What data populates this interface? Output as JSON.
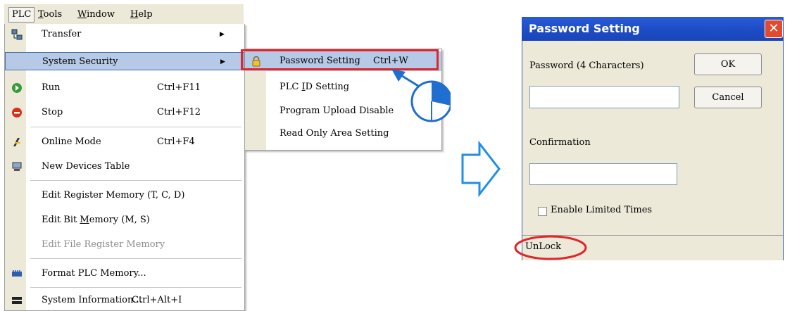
{
  "menubar": {
    "items": [
      "PLC",
      "Tools",
      "Window",
      "Help"
    ],
    "tools_prefix": "T",
    "tools_rest": "ools",
    "window_prefix": "W",
    "window_rest": "indow",
    "help_prefix": "H",
    "help_rest": "elp"
  },
  "plc_menu": {
    "transfer": "Transfer",
    "system_security": "System Security",
    "run": "Run",
    "run_shortcut": "Ctrl+F11",
    "stop": "Stop",
    "stop_shortcut": "Ctrl+F12",
    "online_mode": "Online Mode",
    "online_mode_shortcut": "Ctrl+F4",
    "new_devices_table": "New Devices Table",
    "edit_register_memory": "Edit Register Memory (T, C, D)",
    "edit_bit_memory_a": "Edit Bit ",
    "edit_bit_memory_u": "M",
    "edit_bit_memory_b": "emory (M, S)",
    "edit_file_register_memory": "Edit File Register Memory",
    "format_plc_memory": "Format PLC Memory...",
    "system_information": "System Information...",
    "system_information_shortcut": "Ctrl+Alt+I"
  },
  "submenu": {
    "password_setting": "Password Setting",
    "password_setting_shortcut": "Ctrl+W",
    "plc_id_a": "PLC ",
    "plc_id_u": "I",
    "plc_id_b": "D Setting",
    "program_upload_disable": "Program Upload Disable",
    "read_only_area_setting": "Read Only Area Setting"
  },
  "dialog": {
    "title": "Password Setting",
    "password_label": "Password (4 Characters)",
    "password_value": "",
    "ok": "OK",
    "cancel": "Cancel",
    "confirmation_label": "Confirmation",
    "confirmation_value": "",
    "enable_limited_times": "Enable Limited Times",
    "status": "UnLock"
  },
  "colors": {
    "highlight_red": "#e0262b",
    "arrow_blue": "#1f8fe6",
    "title_blue": "#1c4bc4"
  }
}
